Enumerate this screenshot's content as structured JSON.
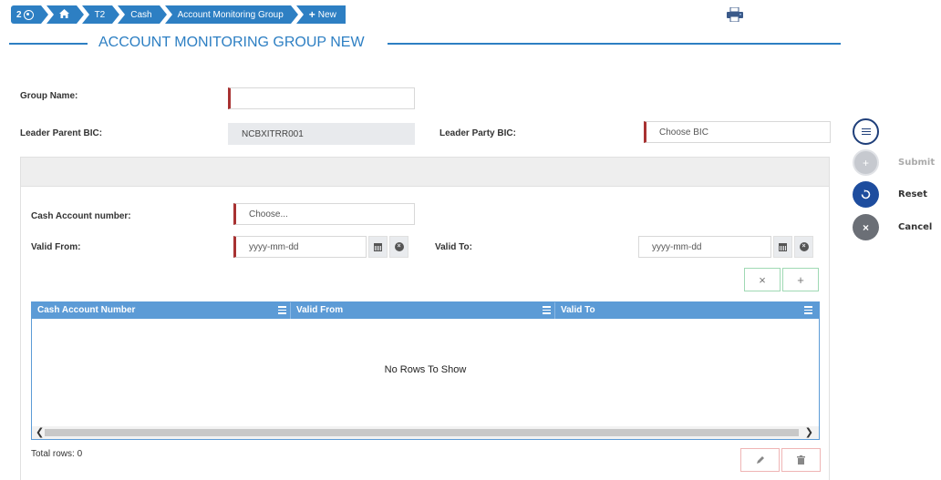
{
  "breadcrumb": {
    "count": "2",
    "items": [
      "T2",
      "Cash",
      "Account Monitoring Group",
      "New"
    ]
  },
  "page_title": "ACCOUNT MONITORING GROUP NEW",
  "form": {
    "group_name_label": "Group Name:",
    "group_name_value": "",
    "leader_parent_bic_label": "Leader Parent BIC:",
    "leader_parent_bic_value": "NCBXITRR001",
    "leader_party_bic_label": "Leader Party BIC:",
    "leader_party_bic_placeholder": "Choose BIC"
  },
  "panel": {
    "cash_account_label": "Cash Account number:",
    "cash_account_placeholder": "Choose...",
    "valid_from_label": "Valid From:",
    "valid_from_placeholder": "yyyy-mm-dd",
    "valid_to_label": "Valid To:",
    "valid_to_placeholder": "yyyy-mm-dd",
    "clear_symbol": "×",
    "add_symbol": "+"
  },
  "grid": {
    "columns": [
      "Cash Account Number",
      "Valid From",
      "Valid To"
    ],
    "empty_text": "No Rows To Show",
    "total_rows": "Total rows: 0"
  },
  "actions": {
    "submit": "Submit",
    "reset": "Reset",
    "cancel": "Cancel"
  },
  "colors": {
    "primary": "#2d7fc3",
    "grid_header": "#5c9bd6",
    "mandatory_marker": "#a83232",
    "reset_button": "#1e4d9e",
    "cancel_button": "#6b6f76"
  }
}
